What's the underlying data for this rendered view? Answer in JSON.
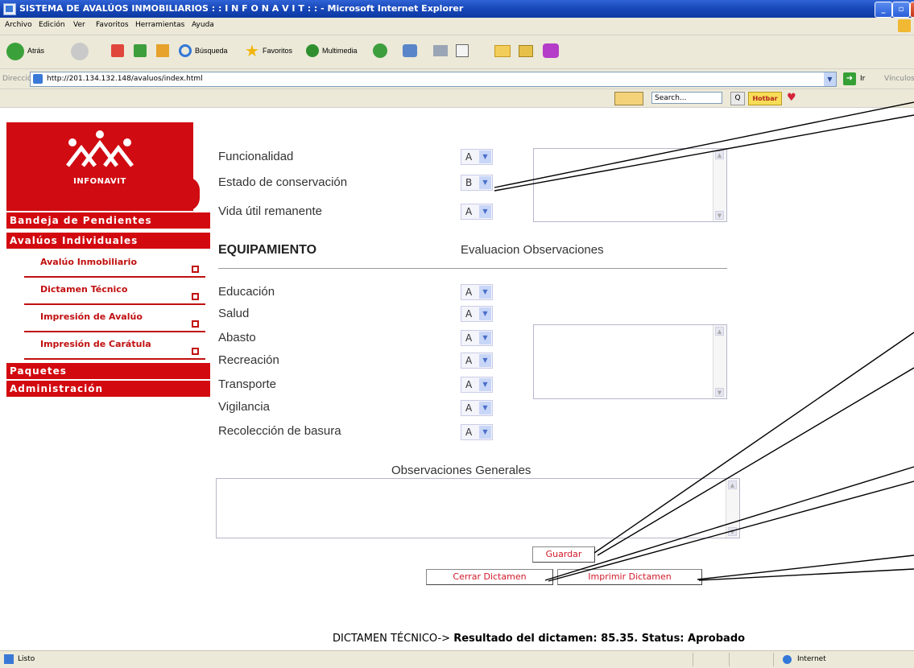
{
  "window": {
    "title": "SISTEMA DE AVALÚOS INMOBILIARIOS : : I N F O N A V I T : : - Microsoft Internet Explorer"
  },
  "menubar": [
    "Archivo",
    "Edición",
    "Ver",
    "Favoritos",
    "Herramientas",
    "Ayuda"
  ],
  "toolbar": {
    "back": "Atrás",
    "search": "Búsqueda",
    "favorites": "Favoritos",
    "media": "Multimedia"
  },
  "address": {
    "label": "Dirección",
    "url": "http://201.134.132.148/avaluos/index.html",
    "go": "Ir",
    "links": "Vínculos"
  },
  "searchbar": {
    "search_placeholder": "Search...",
    "hotbar": "Hotbar"
  },
  "logo": {
    "text": "INFONAVIT"
  },
  "nav": {
    "bandeja": "Bandeja de Pendientes",
    "avaluos": "Avalúos Individuales",
    "sub": [
      "Avalúo Inmobiliario",
      "Dictamen Técnico",
      "Impresión de Avalúo",
      "Impresión de Carátula"
    ],
    "paquetes": "Paquetes",
    "administracion": "Administración"
  },
  "form": {
    "top_rows": [
      {
        "label": "Funcionalidad",
        "value": "A"
      },
      {
        "label": "Estado de conservación",
        "value": "B"
      },
      {
        "label": "Vida útil remanente",
        "value": "A"
      }
    ],
    "equipamiento": {
      "title": "EQUIPAMIENTO",
      "header": "Evaluacion Observaciones",
      "rows": [
        {
          "label": "Educación",
          "value": "A"
        },
        {
          "label": "Salud",
          "value": "A"
        },
        {
          "label": "Abasto",
          "value": "A"
        },
        {
          "label": "Recreación",
          "value": "A"
        },
        {
          "label": "Transporte",
          "value": "A"
        },
        {
          "label": "Vigilancia",
          "value": "A"
        },
        {
          "label": "Recolección de basura",
          "value": "A"
        }
      ]
    },
    "obs_general_label": "Observaciones Generales",
    "buttons": {
      "guardar": "Guardar",
      "cerrar": "Cerrar Dictamen",
      "imprimir": "Imprimir Dictamen"
    },
    "result": {
      "prefix": "DICTAMEN TÉCNICO->",
      "text": "Resultado del dictamen: 85.35. Status: Aprobado"
    }
  },
  "status": {
    "text": "Listo",
    "zone": "Internet"
  }
}
